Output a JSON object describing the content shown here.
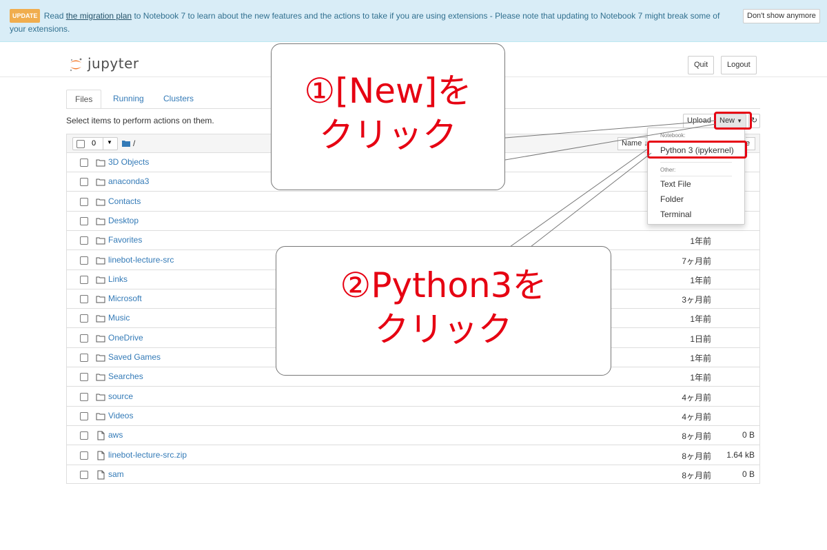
{
  "banner": {
    "badge": "UPDATE",
    "text_before_link": "Read ",
    "link": "the migration plan",
    "text_after_link": " to Notebook 7 to learn about the new features and the actions to take if you are using extensions - Please note that updating to Notebook 7 might break some of your extensions.",
    "dismiss_label": "Don't show anymore"
  },
  "header": {
    "logo_text": "jupyter",
    "quit_label": "Quit",
    "logout_label": "Logout"
  },
  "tabs": [
    {
      "label": "Files"
    },
    {
      "label": "Running"
    },
    {
      "label": "Clusters"
    }
  ],
  "toolbar": {
    "hint": "Select items to perform actions on them.",
    "upload_label": "Upload",
    "new_label": "New",
    "refresh_icon": "refresh-icon"
  },
  "list_header": {
    "selected_count": "0",
    "path": "/",
    "name_sort_label": "Name",
    "sort_icon": "arrow-down-icon"
  },
  "new_menu": {
    "notebook_header": "Notebook:",
    "python_item": "Python 3 (ipykernel)",
    "other_header": "Other:",
    "items": [
      "Text File",
      "Folder",
      "Terminal"
    ]
  },
  "files": [
    {
      "name": "3D Objects",
      "type": "folder",
      "modified": "",
      "size": ""
    },
    {
      "name": "anaconda3",
      "type": "folder",
      "modified": "",
      "size": ""
    },
    {
      "name": "Contacts",
      "type": "folder",
      "modified": "",
      "size": ""
    },
    {
      "name": "Desktop",
      "type": "folder",
      "modified": "",
      "size": ""
    },
    {
      "name": "Favorites",
      "type": "folder",
      "modified": "1年前",
      "size": ""
    },
    {
      "name": "linebot-lecture-src",
      "type": "folder",
      "modified": "7ヶ月前",
      "size": ""
    },
    {
      "name": "Links",
      "type": "folder",
      "modified": "1年前",
      "size": ""
    },
    {
      "name": "Microsoft",
      "type": "folder",
      "modified": "3ヶ月前",
      "size": ""
    },
    {
      "name": "Music",
      "type": "folder",
      "modified": "1年前",
      "size": ""
    },
    {
      "name": "OneDrive",
      "type": "folder",
      "modified": "1日前",
      "size": ""
    },
    {
      "name": "Saved Games",
      "type": "folder",
      "modified": "1年前",
      "size": ""
    },
    {
      "name": "Searches",
      "type": "folder",
      "modified": "1年前",
      "size": ""
    },
    {
      "name": "source",
      "type": "folder",
      "modified": "4ヶ月前",
      "size": ""
    },
    {
      "name": "Videos",
      "type": "folder",
      "modified": "4ヶ月前",
      "size": ""
    },
    {
      "name": "aws",
      "type": "file",
      "modified": "8ヶ月前",
      "size": "0 B"
    },
    {
      "name": "linebot-lecture-src.zip",
      "type": "file",
      "modified": "8ヶ月前",
      "size": "1.64 kB"
    },
    {
      "name": "sam",
      "type": "file",
      "modified": "8ヶ月前",
      "size": "0 B"
    }
  ],
  "annotations": {
    "step1_line1": "①[New]を",
    "step1_line2": "クリック",
    "step2_line1": "②Python3を",
    "step2_line2": "クリック",
    "highlight_color": "#e60012"
  }
}
